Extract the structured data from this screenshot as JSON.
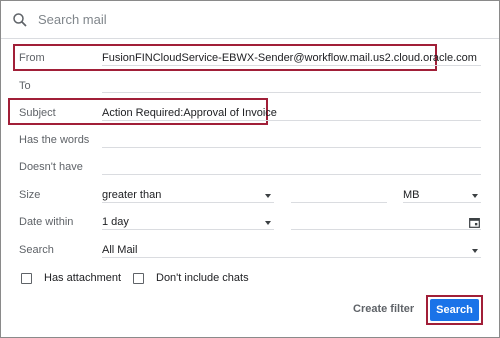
{
  "search": {
    "placeholder": "Search mail"
  },
  "form": {
    "from": {
      "label": "From",
      "value": "FusionFINCloudService-EBWX-Sender@workflow.mail.us2.cloud.oracle.com"
    },
    "to": {
      "label": "To",
      "value": ""
    },
    "subject": {
      "label": "Subject",
      "value": "Action Required:Approval of Invoice"
    },
    "has_words": {
      "label": "Has the words",
      "value": ""
    },
    "doesnt_have": {
      "label": "Doesn't have",
      "value": ""
    },
    "size": {
      "label": "Size",
      "operator": "greater than",
      "amount": "",
      "unit": "MB"
    },
    "date_within": {
      "label": "Date within",
      "value": "1 day",
      "date": ""
    },
    "search_in": {
      "label": "Search",
      "value": "All Mail"
    },
    "has_attachment": {
      "label": "Has attachment",
      "checked": false
    },
    "dont_include_chats": {
      "label": "Don't include chats",
      "checked": false
    }
  },
  "actions": {
    "create_filter": "Create filter",
    "search": "Search"
  },
  "colors": {
    "highlight": "#a11f38",
    "primary": "#1a73e8"
  },
  "icons": {
    "search": "search-icon",
    "calendar": "calendar-icon",
    "dropdown": "chevron-down-icon"
  }
}
